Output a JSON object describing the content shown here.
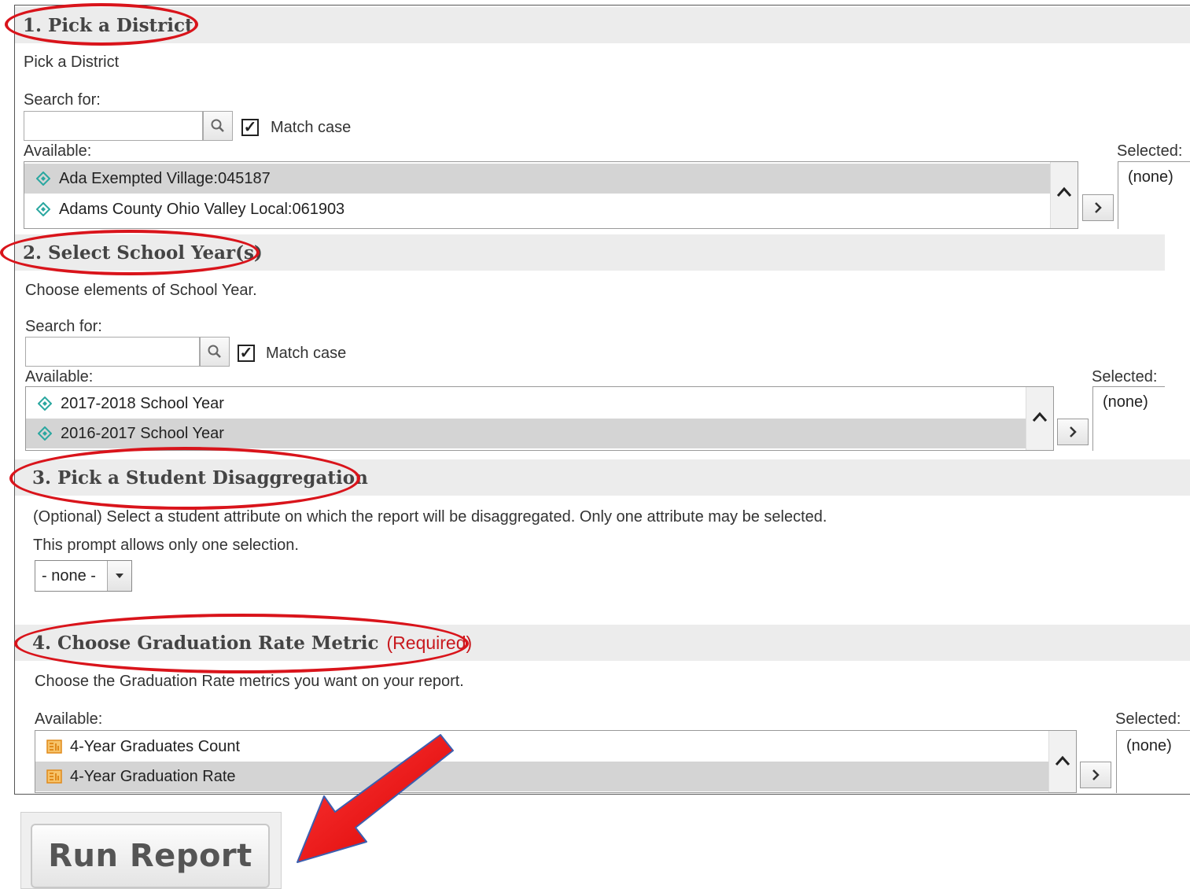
{
  "section1": {
    "header": "1. Pick a District",
    "prompt": "Pick a District",
    "search_label": "Search for:",
    "match_case": "Match case",
    "available_label": "Available:",
    "selected_label": "Selected:",
    "selected_value": "(none)",
    "items": [
      {
        "label": "Ada Exempted Village:045187",
        "selected": true
      },
      {
        "label": "Adams County Ohio Valley Local:061903",
        "selected": false
      }
    ]
  },
  "section2": {
    "header": "2. Select School Year(s)",
    "prompt": "Choose elements of School Year.",
    "search_label": "Search for:",
    "match_case": "Match case",
    "available_label": "Available:",
    "selected_label": "Selected:",
    "selected_value": "(none)",
    "items": [
      {
        "label": "2017-2018 School Year",
        "selected": false
      },
      {
        "label": "2016-2017 School Year",
        "selected": true
      }
    ]
  },
  "section3": {
    "header": "3. Pick a Student Disaggregation",
    "prompt": "(Optional) Select a student attribute on which the report will be disaggregated.  Only one attribute may be selected.",
    "note": "This prompt allows only one selection.",
    "dropdown_value": "- none -"
  },
  "section4": {
    "header": "4. Choose Graduation Rate Metric",
    "required": "(Required)",
    "prompt": "Choose the Graduation Rate metrics you want on your report.",
    "available_label": "Available:",
    "selected_label": "Selected:",
    "selected_value": "(none)",
    "items": [
      {
        "label": "4-Year Graduates Count",
        "selected": false
      },
      {
        "label": "4-Year Graduation Rate",
        "selected": true
      }
    ]
  },
  "run_button": "Run Report",
  "colors": {
    "annotation_red": "#d9141b",
    "header_bg": "#ececec",
    "selected_row": "#d4d4d4",
    "diamond_teal": "#2aa7a0",
    "metric_orange": "#f0a030"
  }
}
